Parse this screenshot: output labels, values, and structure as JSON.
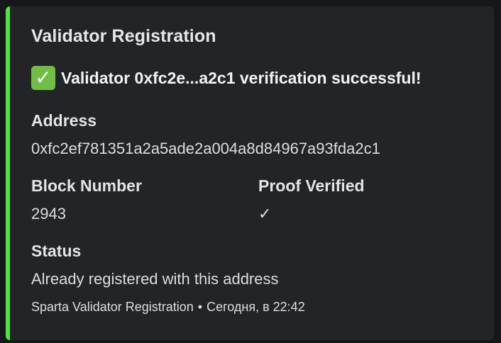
{
  "embed": {
    "accent_color": "#4fe33f",
    "title": "Validator Registration",
    "description_icon": "white-check-mark-icon",
    "description": "Validator 0xfc2e...a2c1 verification successful!",
    "fields": {
      "address": {
        "name": "Address",
        "value": "0xfc2ef781351a2a5ade2a004a8d84967a93fda2c1"
      },
      "block_number": {
        "name": "Block Number",
        "value": "2943"
      },
      "proof_verified": {
        "name": "Proof Verified",
        "value": "✓"
      },
      "status": {
        "name": "Status",
        "value": "Already registered with this address"
      }
    },
    "footer": {
      "text": "Sparta Validator Registration",
      "separator": "•",
      "timestamp": "Сегодня, в 22:42"
    }
  }
}
